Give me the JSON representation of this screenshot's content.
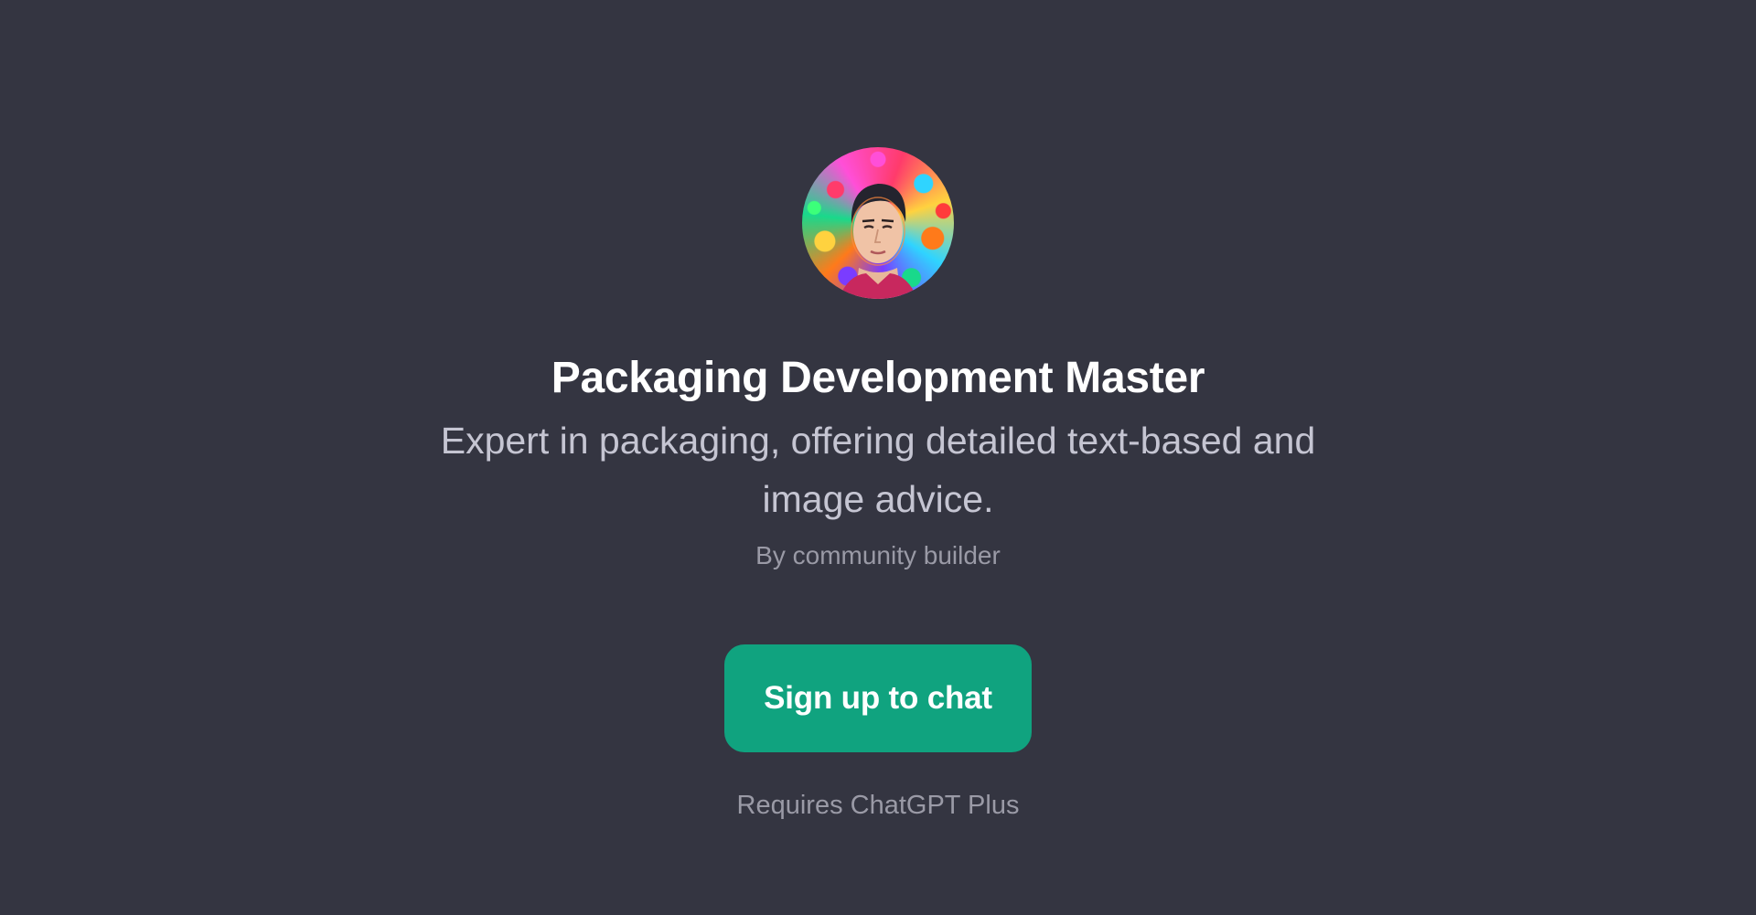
{
  "gpt": {
    "avatar_icon": "portrait-avatar-icon",
    "title": "Packaging Development Master",
    "description": "Expert in packaging, offering detailed text-based and image advice.",
    "author": "By community builder"
  },
  "actions": {
    "signup_label": "Sign up to chat",
    "requirement": "Requires ChatGPT Plus"
  },
  "colors": {
    "background": "#343541",
    "accent": "#10a37f",
    "title_text": "#ffffff",
    "description_text": "#c5c5d2",
    "muted_text": "#9a9aa6"
  }
}
